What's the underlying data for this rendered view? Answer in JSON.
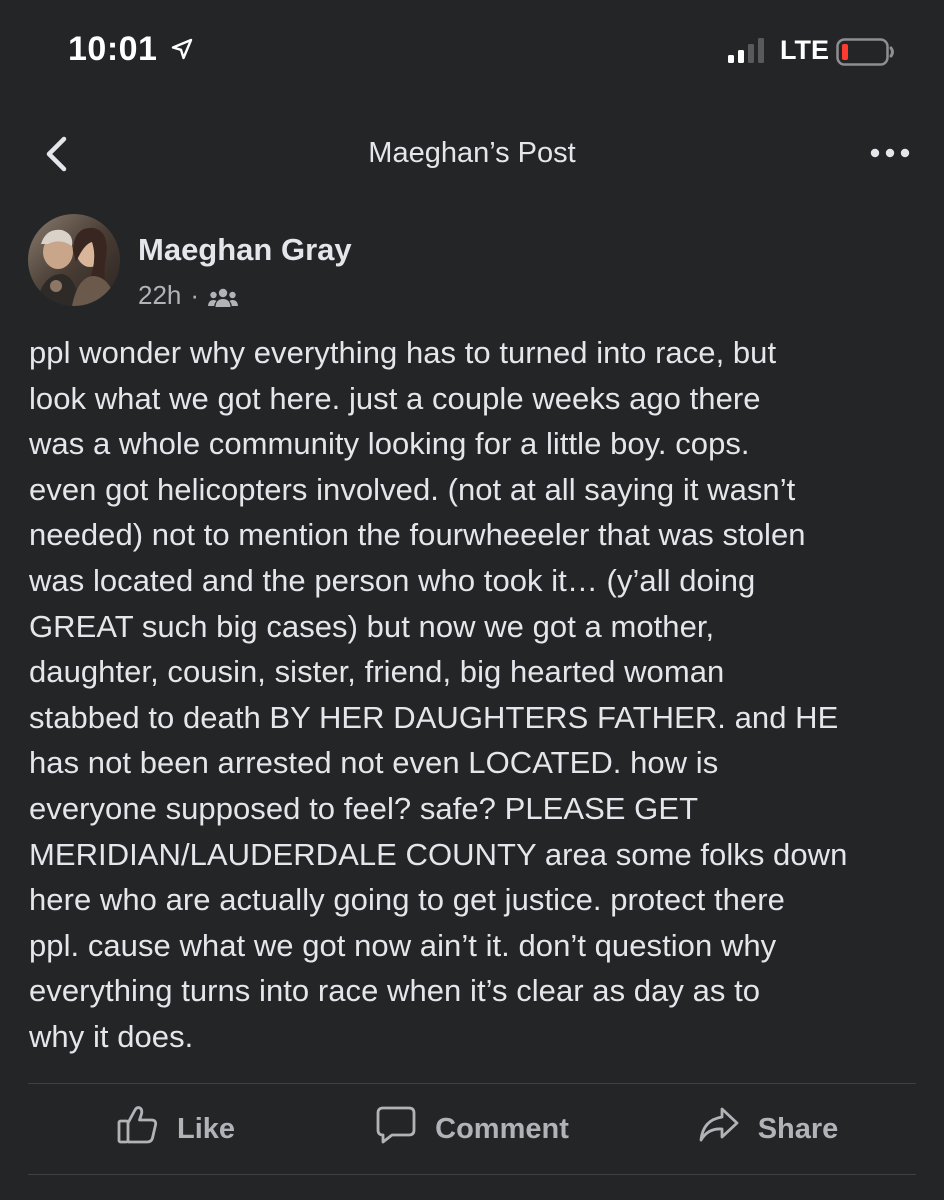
{
  "status_bar": {
    "time": "10:01",
    "network": "LTE",
    "icons": [
      "location-arrow-icon",
      "signal-bars-icon",
      "battery-low-icon"
    ],
    "battery_color": "#ff3b30"
  },
  "nav": {
    "title": "Maeghan’s Post",
    "back_icon": "chevron-left-icon",
    "more_icon": "more-horizontal-icon"
  },
  "post": {
    "author": "Maeghan Gray",
    "time_ago": "22h",
    "separator": "·",
    "audience_icon": "friends-icon",
    "body": "ppl wonder why everything has to turned into race, but\nlook what we got here. just a couple weeks ago there\nwas a whole community looking for a little boy. cops.\neven got helicopters involved. (not at all saying it wasn’t\nneeded) not to mention the fourwheeeler that was stolen\nwas located and the person who took it… (y’all doing\nGREAT such big cases) but now we got a mother,\ndaughter, cousin, sister, friend, big hearted woman\nstabbed to death BY HER DAUGHTERS FATHER. and HE\nhas not been arrested not even LOCATED. how is\neveryone supposed to feel? safe? PLEASE GET\nMERIDIAN/LAUDERDALE COUNTY area some folks down\nhere who are actually going to get justice. protect there\nppl. cause what we got now ain’t it. don’t question why\neverything turns into race when it’s clear as day as to\nwhy it does."
  },
  "actions": {
    "like": "Like",
    "comment": "Comment",
    "share": "Share"
  },
  "colors": {
    "background": "#242526",
    "primary_text": "#e4e6eb",
    "secondary_text": "#b0b3b8",
    "divider": "#3e4042"
  }
}
